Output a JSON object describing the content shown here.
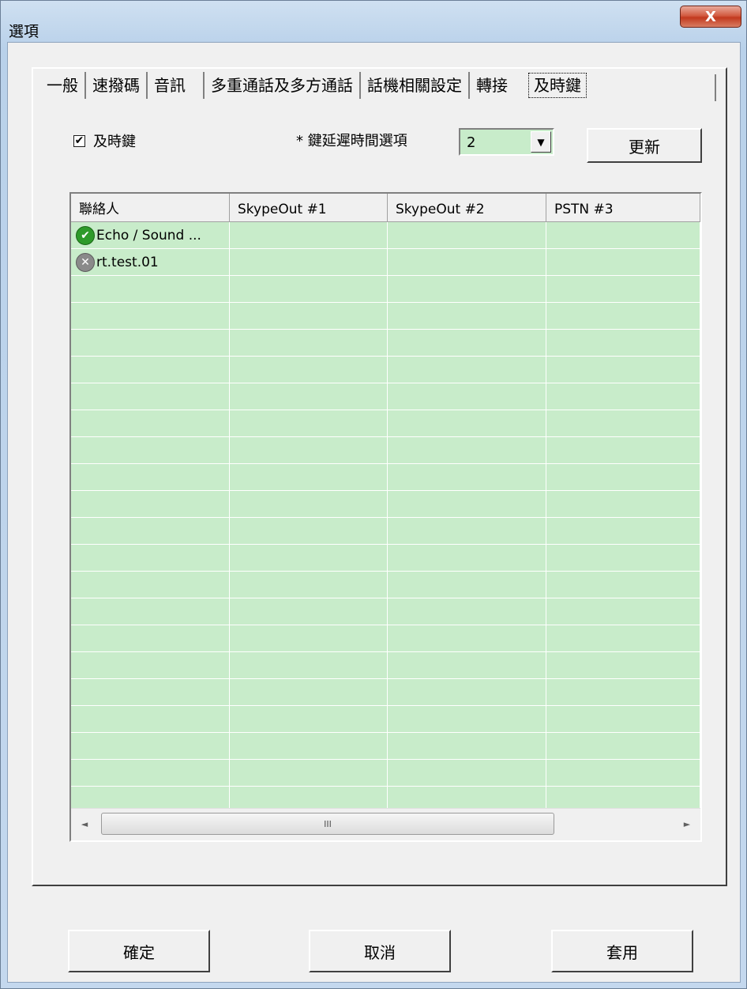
{
  "window": {
    "title": "選項",
    "close_label": "X"
  },
  "tabs": [
    "一般",
    "速撥碼",
    "音訊",
    "多重通話及多方通話",
    "話機相關設定",
    "轉接",
    "及時鍵"
  ],
  "active_tab": "及時鍵",
  "hotkey_checkbox": {
    "label": "及時鍵",
    "checked": true,
    "mark": "✔"
  },
  "delay": {
    "label": "* 鍵延遲時間選項",
    "value": "2",
    "arrow": "▼"
  },
  "refresh_button": "更新",
  "grid": {
    "columns": [
      "聯絡人",
      "SkypeOut #1",
      "SkypeOut #2",
      "PSTN #3"
    ],
    "rows": [
      {
        "contact": "Echo / Sound ...",
        "status": "online",
        "icon": "✔"
      },
      {
        "contact": "rt.test.01",
        "status": "offline",
        "icon": "✕"
      }
    ],
    "scroll_left": "◄",
    "scroll_right": "►",
    "scroll_grip": "III"
  },
  "footer": {
    "ok": "確定",
    "cancel": "取消",
    "apply": "套用"
  }
}
